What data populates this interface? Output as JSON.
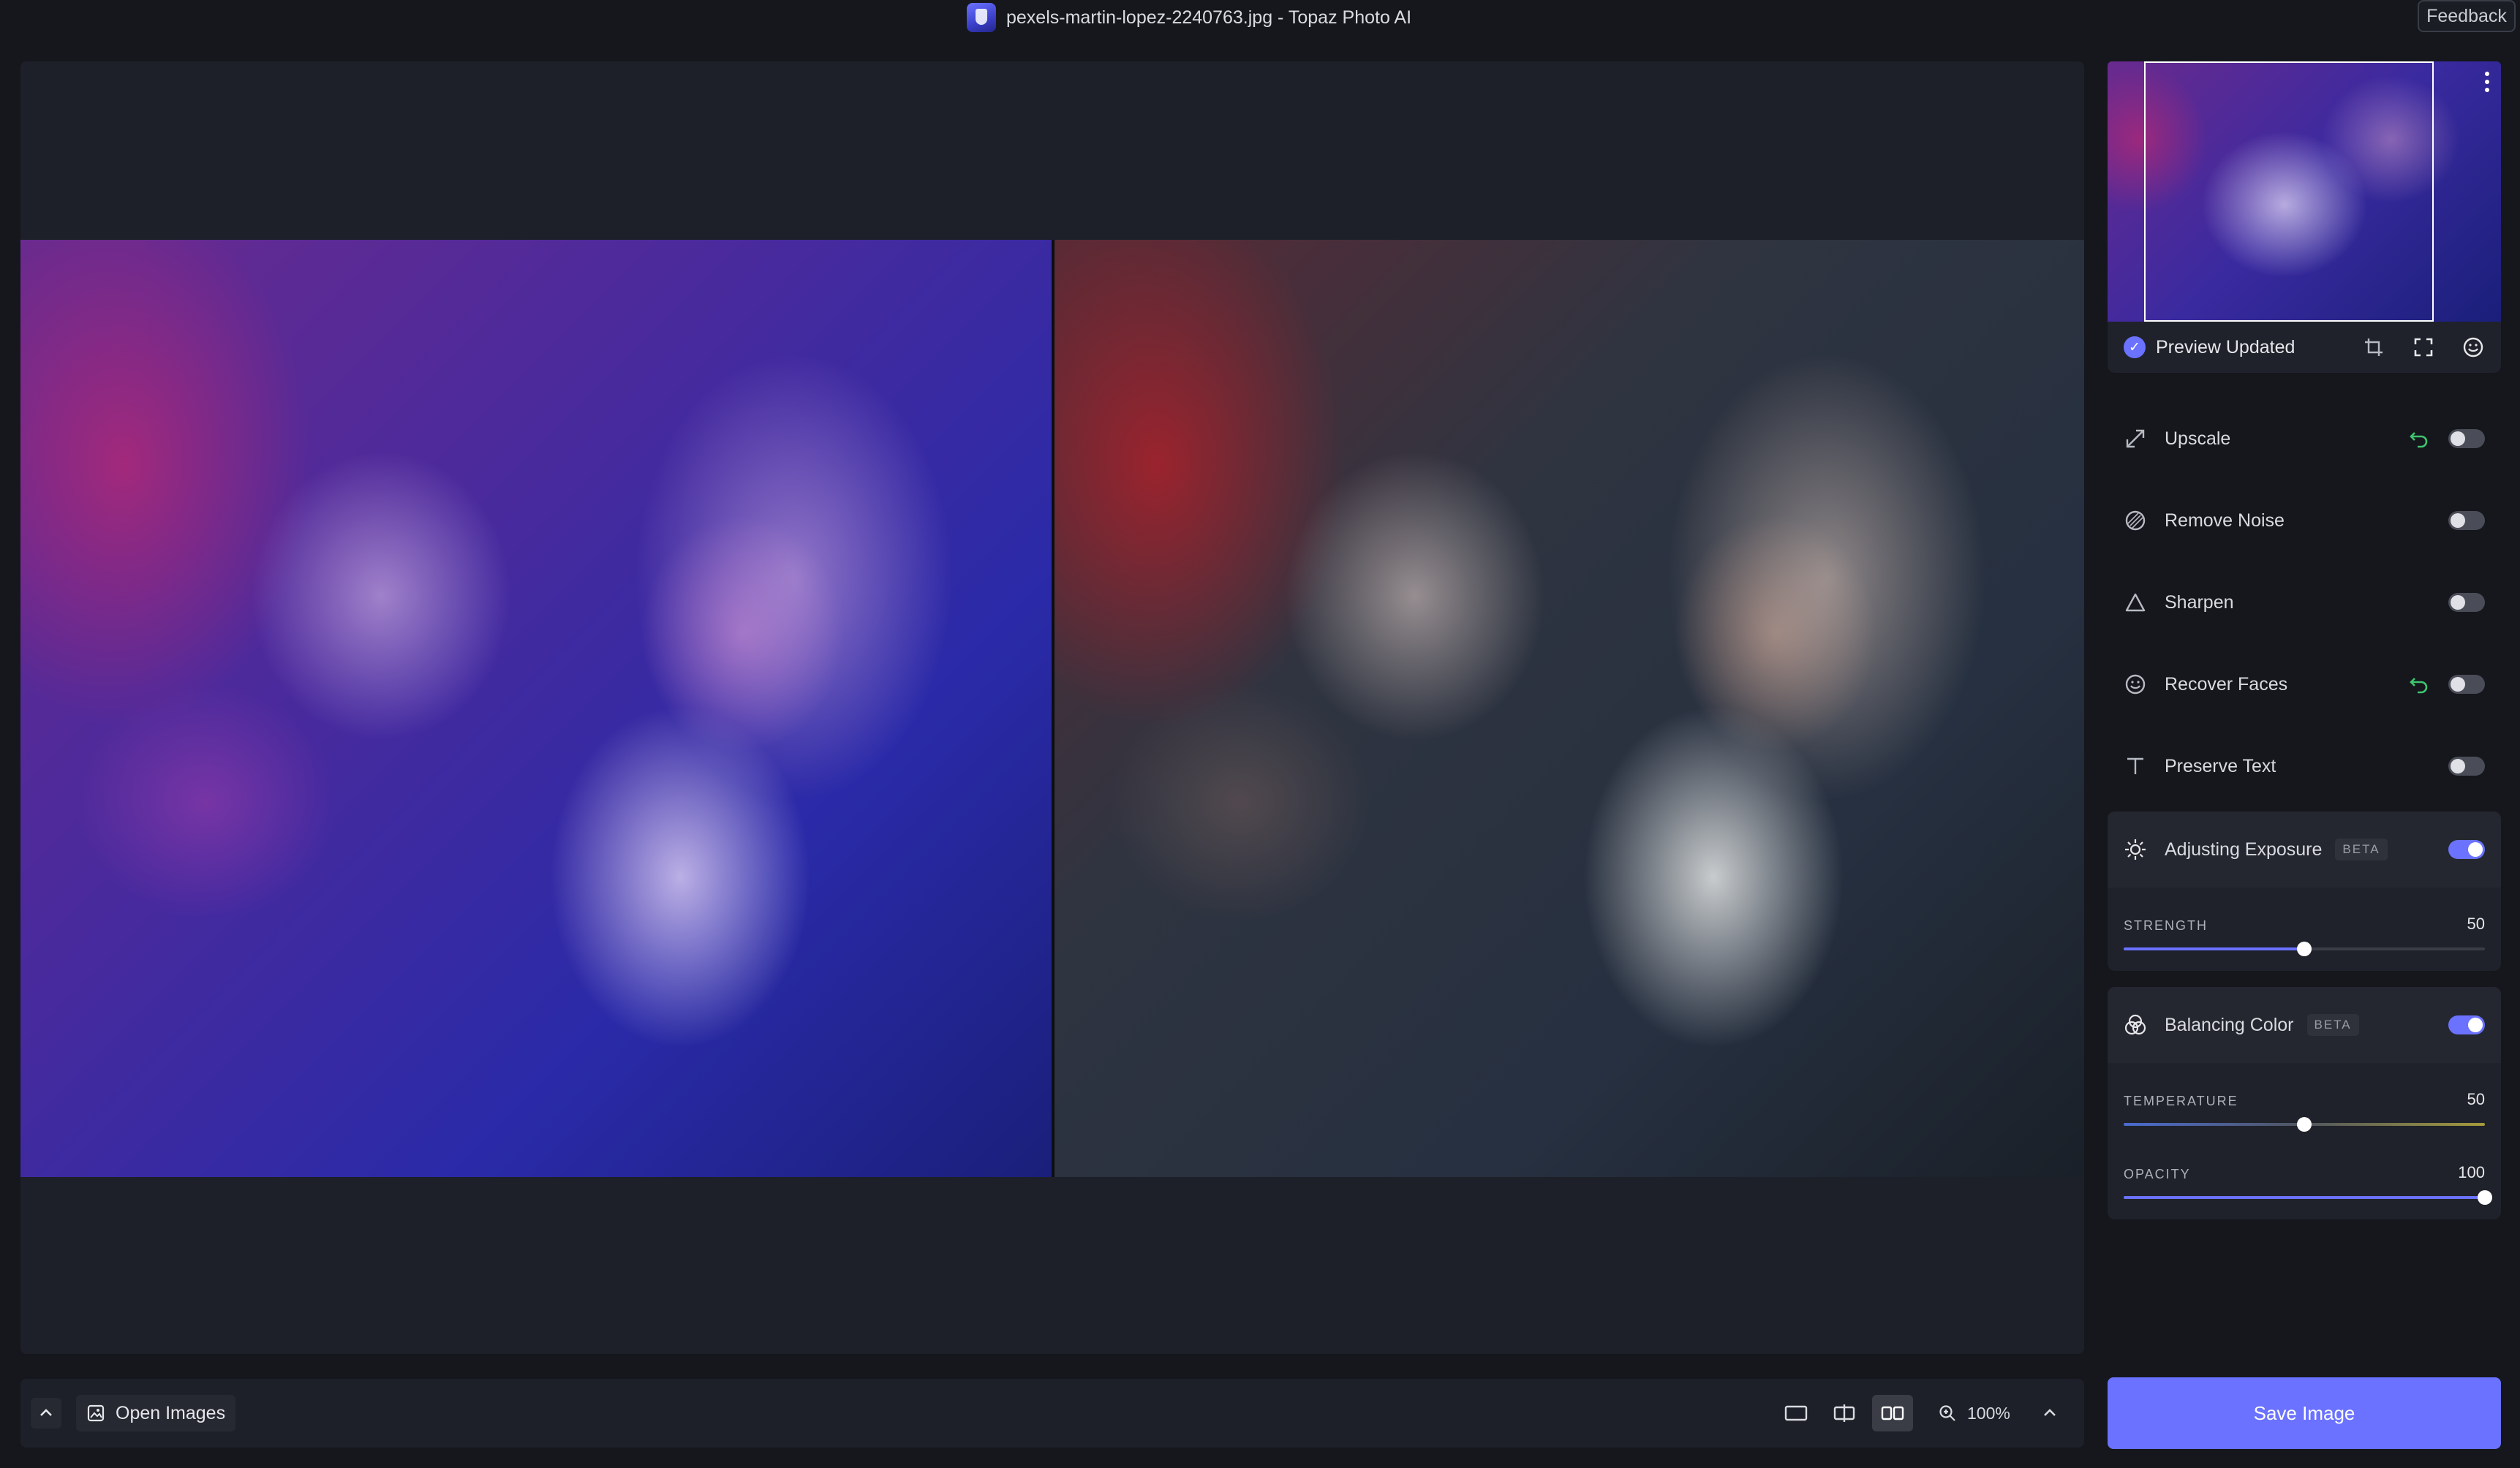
{
  "window": {
    "title": "pexels-martin-lopez-2240763.jpg - Topaz Photo AI",
    "feedback_label": "Feedback"
  },
  "preview": {
    "status": "Preview Updated"
  },
  "tools": [
    {
      "label": "Upscale",
      "icon": "upscale-icon",
      "has_undo": true,
      "enabled": false
    },
    {
      "label": "Remove Noise",
      "icon": "noise-icon",
      "has_undo": false,
      "enabled": false
    },
    {
      "label": "Sharpen",
      "icon": "sharpen-icon",
      "has_undo": false,
      "enabled": false
    },
    {
      "label": "Recover Faces",
      "icon": "face-icon",
      "has_undo": true,
      "enabled": false
    },
    {
      "label": "Preserve Text",
      "icon": "text-icon",
      "has_undo": false,
      "enabled": false
    }
  ],
  "exposure": {
    "label": "Adjusting Exposure",
    "badge": "BETA",
    "enabled": true,
    "strength_label": "STRENGTH",
    "strength_value": "50",
    "strength_fraction": 0.5
  },
  "color": {
    "label": "Balancing Color",
    "badge": "BETA",
    "enabled": true,
    "temperature_label": "TEMPERATURE",
    "temperature_value": "50",
    "temperature_fraction": 0.5,
    "opacity_label": "OPACITY",
    "opacity_value": "100",
    "opacity_fraction": 1.0
  },
  "bottom": {
    "open_images_label": "Open Images",
    "zoom_level": "100%",
    "active_view_mode": "side-by-side"
  },
  "save_label": "Save Image",
  "colors": {
    "accent": "#6a72ff",
    "background": "#15171d",
    "panel": "#1d2028"
  }
}
